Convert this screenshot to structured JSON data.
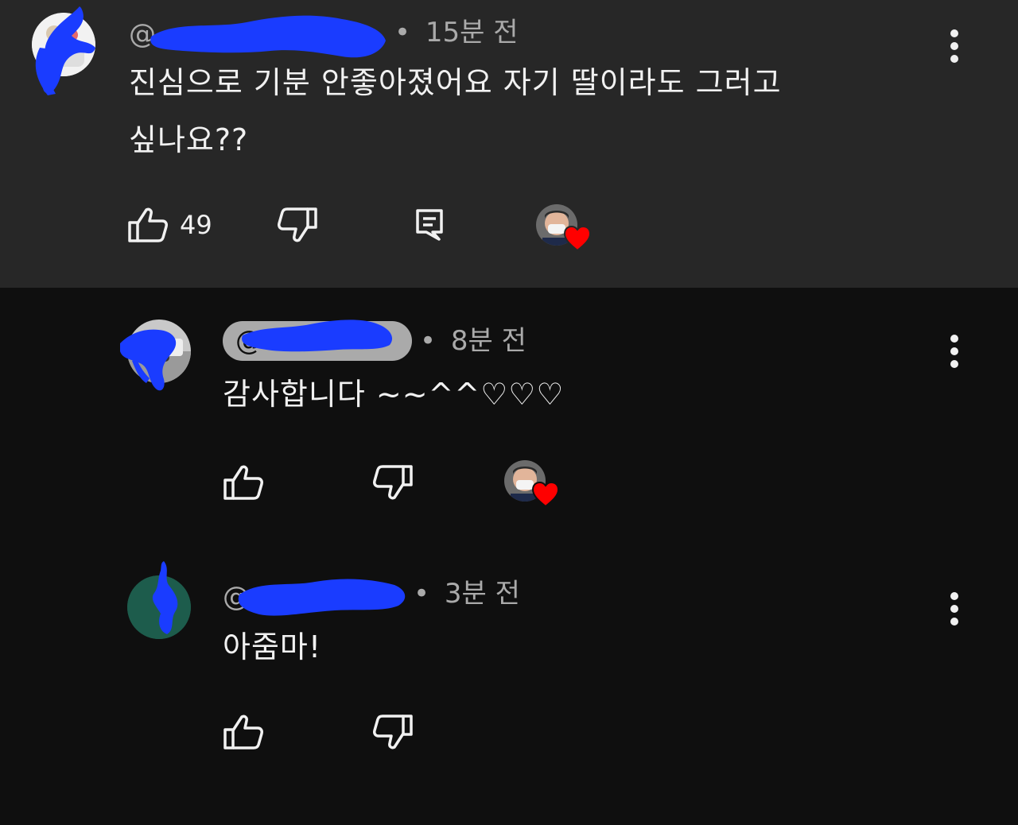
{
  "comments": [
    {
      "handle": "@",
      "time_sep": "•",
      "time": "15분 전",
      "body_line1": "진심으로 기분 안좋아졌어요 자기 딸이라도 그러고",
      "body_line2": "싶나요??",
      "like_count": "49",
      "highlighted": true
    },
    {
      "handle": "@",
      "time_sep": "•",
      "time": "8분 전",
      "body": "감사합니다 ~~^^♡♡♡"
    },
    {
      "handle": "@",
      "time_sep": "•",
      "time": "3분 전",
      "body": "아줌마!"
    }
  ],
  "icons": {
    "like": "thumbs-up-icon",
    "dislike": "thumbs-down-icon",
    "reply": "reply-icon",
    "more": "more-vert-icon",
    "creator_heart": "creator-heart-icon"
  },
  "colors": {
    "highlight_bg": "#272727",
    "page_bg": "#0f0f0f",
    "scribble": "#1a3cff",
    "heart": "#ff0000"
  }
}
